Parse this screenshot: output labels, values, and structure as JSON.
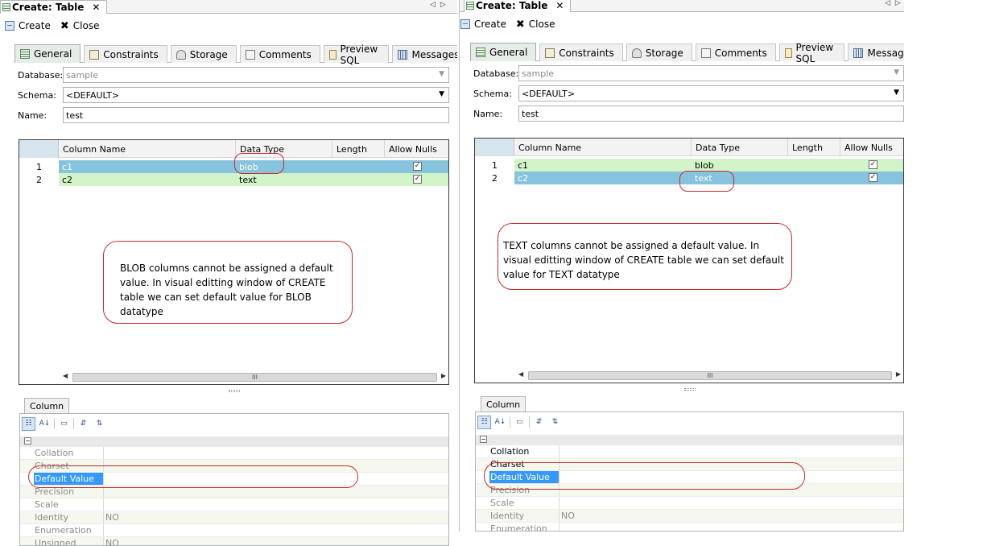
{
  "panes": [
    {
      "editor_tab": "Create: Table",
      "toolbar": {
        "create": "Create",
        "close": "Close"
      },
      "tabs": [
        "General",
        "Constraints",
        "Storage",
        "Comments",
        "Preview SQL",
        "Messages"
      ],
      "form": {
        "database_label": "Database:",
        "database_value": "sample",
        "schema_label": "Schema:",
        "schema_value": "<DEFAULT>",
        "name_label": "Name:",
        "name_value": "test"
      },
      "grid": {
        "headers": [
          "Column Name",
          "Data Type",
          "Length",
          "Allow Nulls"
        ],
        "rows": [
          {
            "num": "1",
            "name": "c1",
            "type": "blob",
            "nulls": "✓"
          },
          {
            "num": "2",
            "name": "c2",
            "type": "text",
            "nulls": "✓"
          }
        ],
        "scroll_thumb": "III"
      },
      "callout": "BLOB  columns cannot be assigned a default value. In visual editting window of CREATE table we can set default value for BLOB datatype",
      "panel_tab": "Column",
      "properties": [
        {
          "name": "Collation",
          "value": ""
        },
        {
          "name": "Charset",
          "value": ""
        },
        {
          "name": "Default Value",
          "value": ""
        },
        {
          "name": "Precision",
          "value": ""
        },
        {
          "name": "Scale",
          "value": ""
        },
        {
          "name": "Identity",
          "value": "NO"
        },
        {
          "name": "Enumeration",
          "value": ""
        },
        {
          "name": "Unsigned",
          "value": "NO"
        }
      ]
    },
    {
      "editor_tab": "Create: Table",
      "toolbar": {
        "create": "Create",
        "close": "Close"
      },
      "tabs": [
        "General",
        "Constraints",
        "Storage",
        "Comments",
        "Preview SQL",
        "Messages"
      ],
      "form": {
        "database_label": "Database:",
        "database_value": "sample",
        "schema_label": "Schema:",
        "schema_value": "<DEFAULT>",
        "name_label": "Name:",
        "name_value": "test"
      },
      "grid": {
        "headers": [
          "Column Name",
          "Data Type",
          "Length",
          "Allow Nulls"
        ],
        "rows": [
          {
            "num": "1",
            "name": "c1",
            "type": "blob",
            "nulls": "✓"
          },
          {
            "num": "2",
            "name": "c2",
            "type": "text",
            "nulls": "✓"
          }
        ],
        "scroll_thumb": "III"
      },
      "callout": "TEXT columns cannot be assigned a default value. In visual editting window of CREATE table we can set default value for TEXT datatype",
      "panel_tab": "Column",
      "properties": [
        {
          "name": "Collation",
          "value": ""
        },
        {
          "name": "Charset",
          "value": ""
        },
        {
          "name": "Default Value",
          "value": ""
        },
        {
          "name": "Precision",
          "value": ""
        },
        {
          "name": "Scale",
          "value": ""
        },
        {
          "name": "Identity",
          "value": "NO"
        },
        {
          "name": "Enumeration",
          "value": ""
        }
      ]
    }
  ],
  "icons": [
    "table-icon",
    "create-icon",
    "close-icon",
    "chevron-left-icon",
    "chevron-right-icon",
    "dropdown-arrow-icon",
    "checkbox-checked-icon",
    "categorized-icon",
    "sort-alpha-icon",
    "property-pages-icon",
    "expand-icon",
    "collapse-icon"
  ],
  "colors": {
    "selected_row": "#86c3dd",
    "green_row": "#d1f5c9",
    "property_selected": "#3399ff",
    "annotation": "#cc2a2a"
  }
}
